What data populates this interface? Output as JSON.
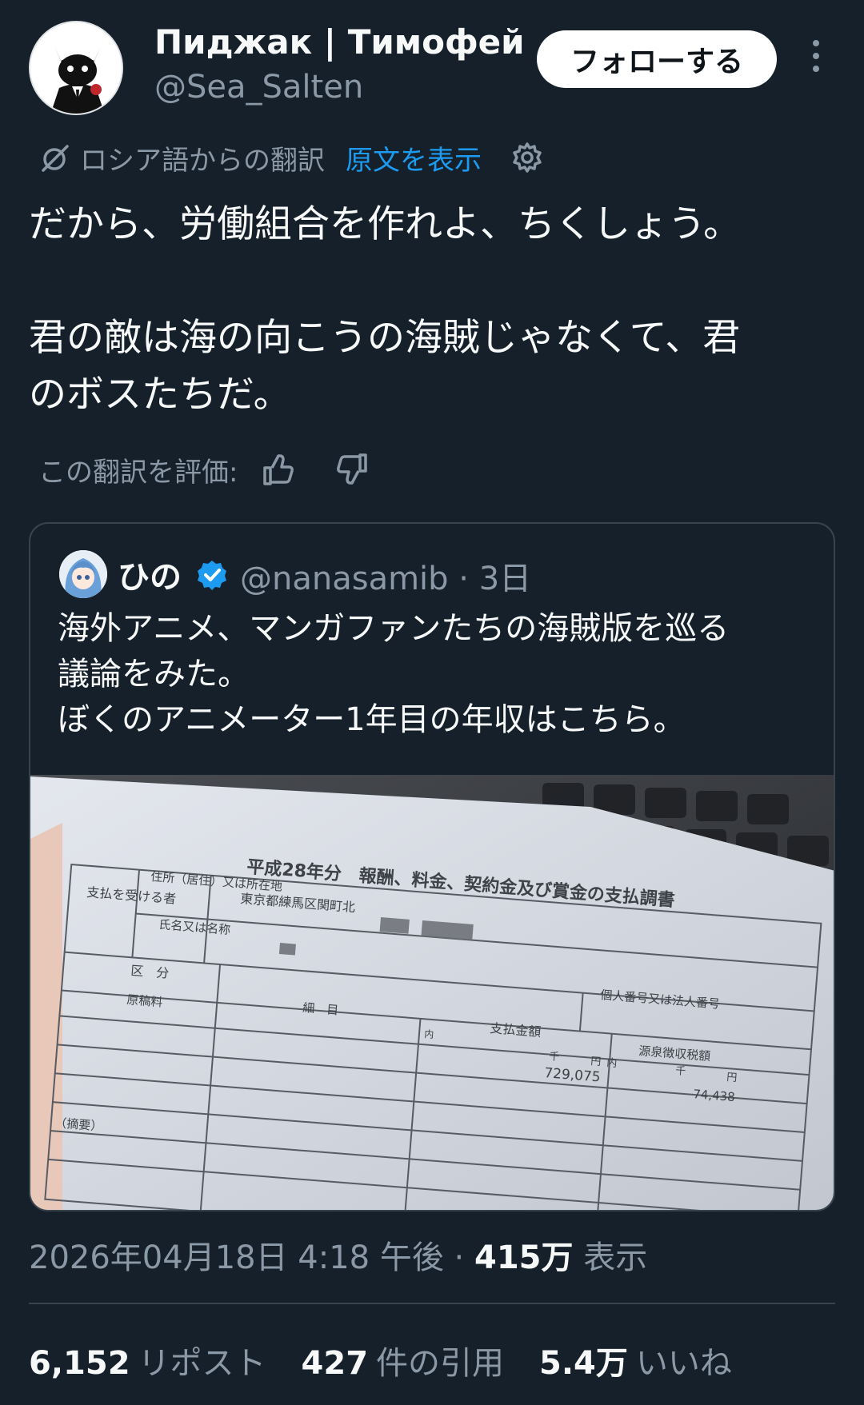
{
  "author": {
    "display_name": "Пиджак | Тимофей",
    "handle": "@Sea_Salten"
  },
  "header": {
    "follow_label": "フォローする"
  },
  "translation": {
    "label": "ロシア語からの翻訳",
    "show_original": "原文を表示"
  },
  "post": {
    "line1": "だから、労働組合を作れよ、ちくしょう。",
    "line2": "君の敵は海の向こうの海賊じゃなくて、君",
    "line3": "のボスたちだ。"
  },
  "rating": {
    "label": "この翻訳を評価:"
  },
  "quoted": {
    "name": "ひの",
    "meta": "@nanasamib · 3日",
    "line1": "海外アニメ、マンガファンたちの海賊版を巡る",
    "line2": "議論をみた。",
    "line3": "ぼくのアニメーター1年目の年収はこちら。",
    "image": {
      "title": "平成28年分　報酬、料金、契約金及び賞金の支払調書",
      "payee_label": "支払を受ける者",
      "address_label": "住所（居住）又は所在地",
      "address_value": "東京都練馬区関町北",
      "name_label": "氏名又は名称",
      "category_label": "区　分",
      "detail_label": "細　目",
      "payment_label": "支払金額",
      "tax_label": "源泉徴収税額",
      "id_label": "個人番号又は法人番号",
      "category_value": "原稿料",
      "unit_thousand": "千",
      "unit_yen": "円",
      "unit_in": "内",
      "payment_value": "729,075",
      "tax_value": "74,438",
      "memo_label": "（摘要）"
    }
  },
  "footer": {
    "timestamp": "2026年04月18日 4:18 午後 · ",
    "views_num": "415万",
    "views_label": " 表示"
  },
  "stats": [
    {
      "num": "6,152",
      "label": "リポスト"
    },
    {
      "num": "427",
      "label": "件の引用"
    },
    {
      "num": "5.4万",
      "label": "いいね"
    }
  ],
  "colors": {
    "background": "#15202b",
    "text": "#f7f9f9",
    "muted": "#8b98a5",
    "link": "#1d9bf0",
    "border": "#38444d"
  }
}
